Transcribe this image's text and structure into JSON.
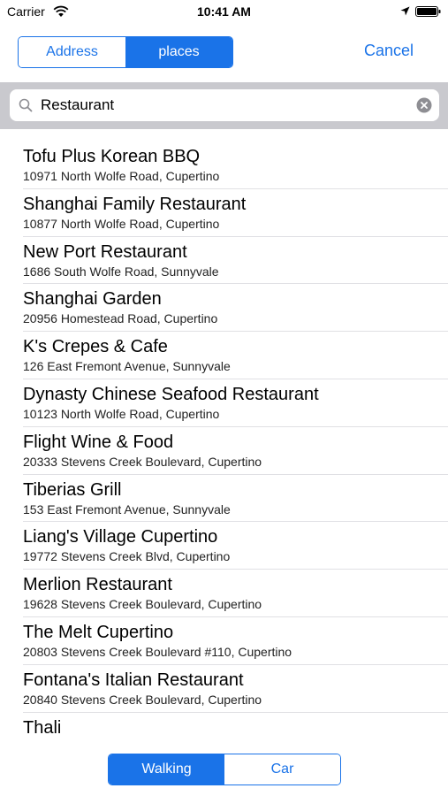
{
  "status": {
    "carrier": "Carrier",
    "time": "10:41 AM"
  },
  "header": {
    "tabs": [
      {
        "label": "Address",
        "selected": false
      },
      {
        "label": "places",
        "selected": true
      }
    ],
    "cancel_label": "Cancel"
  },
  "search": {
    "value": "Restaurant",
    "icon": "search-icon",
    "clear_icon": "clear-icon"
  },
  "results": [
    {
      "name": "Tofu Plus Korean BBQ",
      "address": "10971 North Wolfe Road, Cupertino"
    },
    {
      "name": "Shanghai Family Restaurant",
      "address": "10877 North Wolfe Road, Cupertino"
    },
    {
      "name": "New Port Restaurant",
      "address": "1686 South Wolfe Road, Sunnyvale"
    },
    {
      "name": "Shanghai Garden",
      "address": "20956 Homestead Road, Cupertino"
    },
    {
      "name": "K's Crepes & Cafe",
      "address": "126 East Fremont Avenue, Sunnyvale"
    },
    {
      "name": "Dynasty Chinese Seafood Restaurant",
      "address": "10123 North Wolfe Road, Cupertino"
    },
    {
      "name": "Flight Wine & Food",
      "address": "20333 Stevens Creek Boulevard, Cupertino"
    },
    {
      "name": "Tiberias Grill",
      "address": "153 East Fremont Avenue, Sunnyvale"
    },
    {
      "name": "Liang's Village Cupertino",
      "address": "19772 Stevens Creek Blvd, Cupertino"
    },
    {
      "name": "Merlion Restaurant",
      "address": "19628 Stevens Creek Boulevard, Cupertino"
    },
    {
      "name": "The Melt Cupertino",
      "address": "20803 Stevens Creek Boulevard #110, Cupertino"
    },
    {
      "name": "Fontana's Italian Restaurant",
      "address": "20840 Stevens Creek Boulevard, Cupertino"
    },
    {
      "name": "Thali",
      "address": ""
    }
  ],
  "transport": {
    "options": [
      {
        "label": "Walking",
        "selected": true
      },
      {
        "label": "Car",
        "selected": false
      }
    ]
  },
  "colors": {
    "accent": "#1a73e8",
    "search_bar_bg": "#c9c9ce",
    "separator": "#e0e0e4"
  }
}
